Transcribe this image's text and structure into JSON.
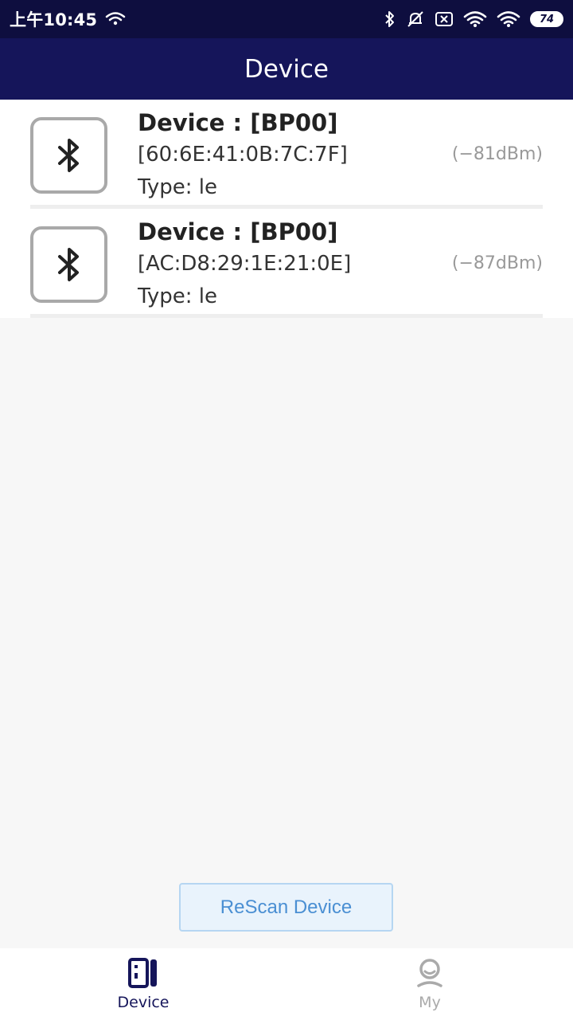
{
  "status_bar": {
    "time": "上午10:45",
    "battery": "74",
    "icons": [
      "wifi-small-icon",
      "bluetooth-icon",
      "mute-bell-icon",
      "no-sim-icon",
      "wifi-icon",
      "wifi-icon-2"
    ]
  },
  "header": {
    "title": "Device"
  },
  "devices": [
    {
      "name": "Device : [BP00]",
      "mac": "[60:6E:41:0B:7C:7F]",
      "type": "Type: le",
      "rssi": "(−81dBm)",
      "icon": "bluetooth-icon"
    },
    {
      "name": "Device : [BP00]",
      "mac": "[AC:D8:29:1E:21:0E]",
      "type": "Type: le",
      "rssi": "(−87dBm)",
      "icon": "bluetooth-icon"
    }
  ],
  "rescan": {
    "label": "ReScan Device"
  },
  "nav": {
    "items": [
      {
        "label": "Device",
        "icon": "device-icon",
        "active": true
      },
      {
        "label": "My",
        "icon": "user-icon",
        "active": false
      }
    ]
  },
  "colors": {
    "header_bg": "#15155a",
    "status_bg": "#0e0e3f",
    "accent": "#4a8fd3",
    "inactive": "#aaaaaa"
  }
}
